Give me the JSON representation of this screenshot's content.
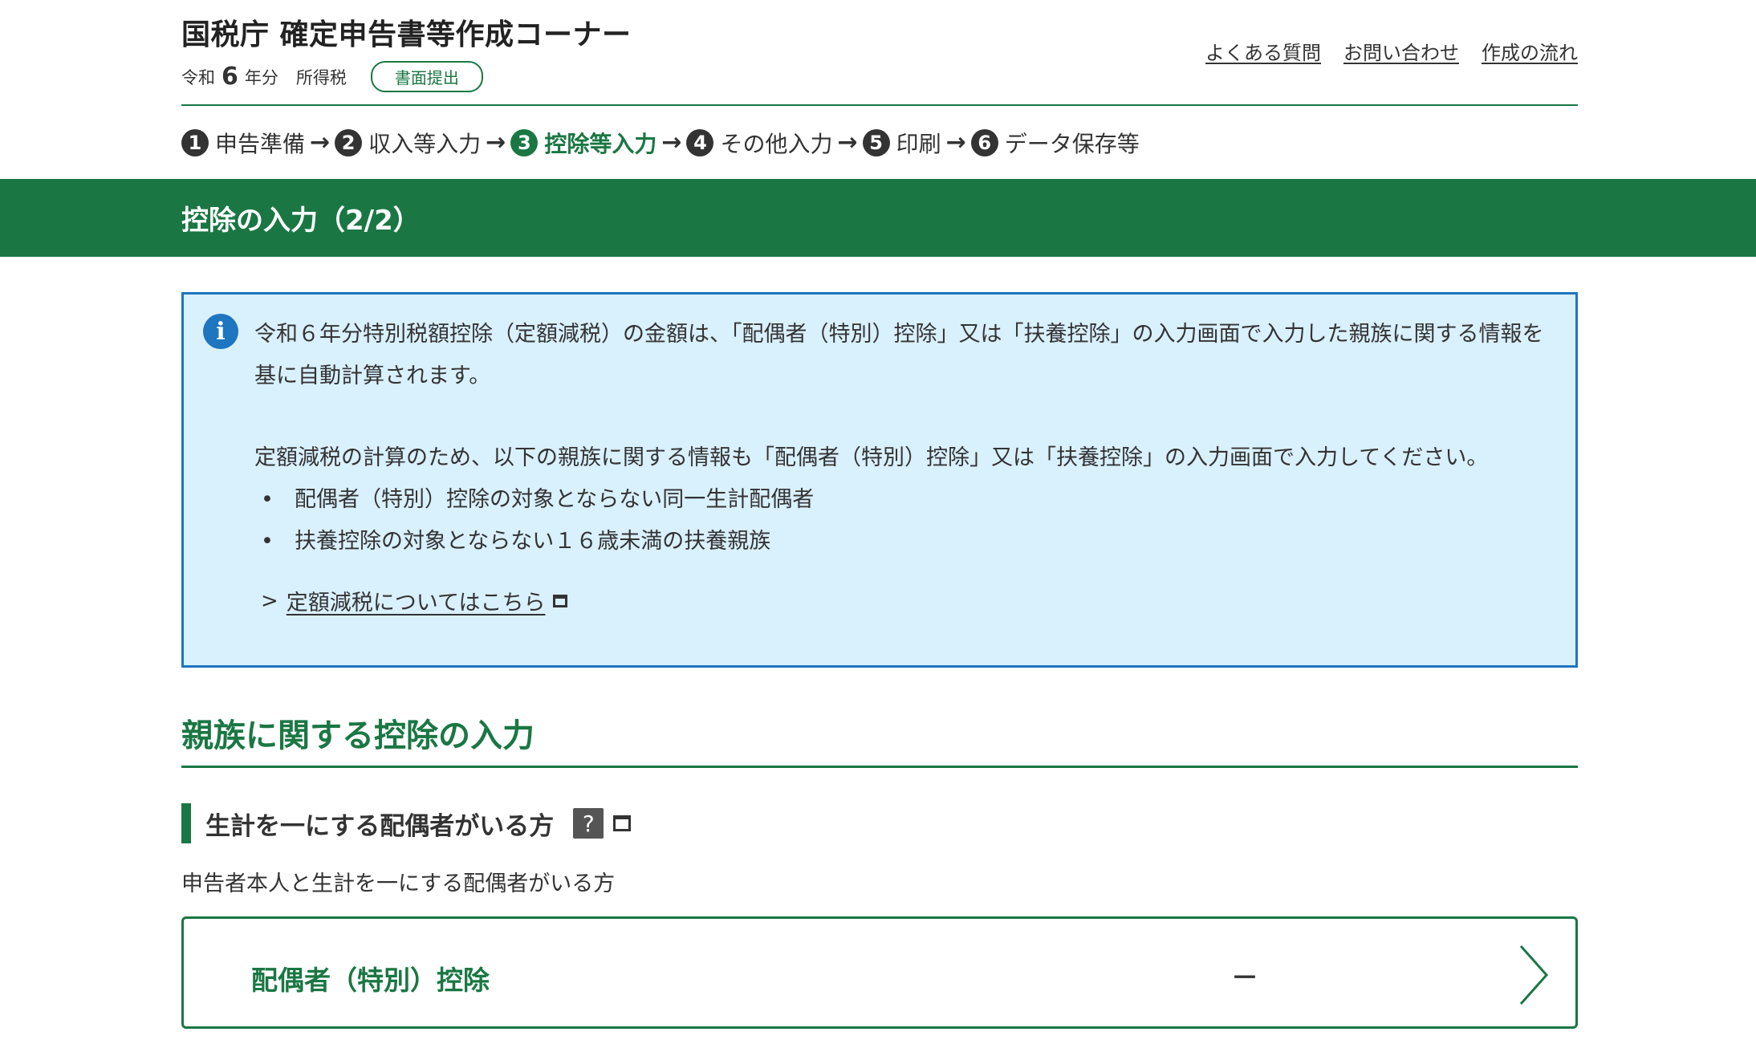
{
  "header": {
    "site_title": "国税庁 確定申告書等作成コーナー",
    "era": "令和",
    "year": "6",
    "year_suffix": "年分",
    "tax_type": "所得税",
    "submission_badge": "書面提出",
    "links": [
      "よくある質問",
      "お問い合わせ",
      "作成の流れ"
    ]
  },
  "steps": [
    {
      "num": "1",
      "label": "申告準備"
    },
    {
      "num": "2",
      "label": "収入等入力"
    },
    {
      "num": "3",
      "label": "控除等入力"
    },
    {
      "num": "4",
      "label": "その他入力"
    },
    {
      "num": "5",
      "label": "印刷"
    },
    {
      "num": "6",
      "label": "データ保存等"
    }
  ],
  "active_step": 3,
  "page_title": "控除の入力（2/2）",
  "info": {
    "icon": "info-icon",
    "para1": "令和６年分特別税額控除（定額減税）の金額は、「配偶者（特別）控除」又は「扶養控除」の入力画面で入力した親族に関する情報を基に自動計算されます。",
    "para2": "定額減税の計算のため、以下の親族に関する情報も「配偶者（特別）控除」又は「扶養控除」の入力画面で入力してください。",
    "bullets": [
      "配偶者（特別）控除の対象とならない同一生計配偶者",
      "扶養控除の対象とならない１６歳未満の扶養親族"
    ],
    "link_text": "定額減税についてはこちら"
  },
  "section": {
    "title": "親族に関する控除の入力",
    "sub_heading": "生計を一にする配偶者がいる方",
    "help_label": "?",
    "description": "申告者本人と生計を一にする配偶者がいる方",
    "card": {
      "label": "配偶者（特別）控除",
      "value": "－"
    }
  },
  "colors": {
    "brand_green": "#1a7743",
    "info_border": "#1e75c0",
    "info_background": "#d9f0fd"
  }
}
